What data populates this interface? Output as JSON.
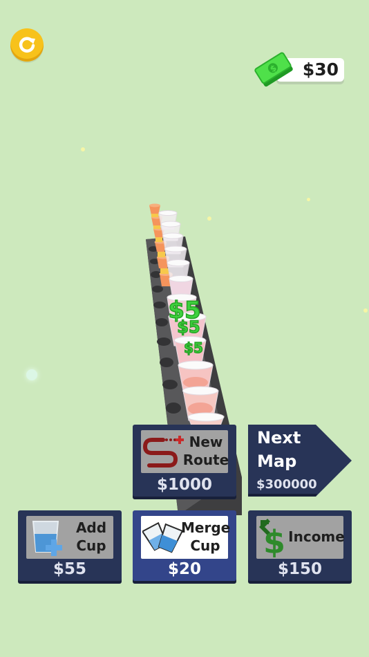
{
  "hud": {
    "money": "$30",
    "restart_icon": "restart-icon",
    "cash_icon": "cash-icon"
  },
  "floating_income": [
    "$5",
    "$5",
    "$5"
  ],
  "upgrades": {
    "new_route": {
      "label_line1": "New",
      "label_line2": "Route",
      "price": "$1000",
      "icon": "route-icon"
    },
    "next_map": {
      "label_line1": "Next",
      "label_line2": "Map",
      "price": "$300000"
    },
    "add_cup": {
      "label_line1": "Add",
      "label_line2": "Cup",
      "price": "$55",
      "icon": "add-cup-icon"
    },
    "merge_cup": {
      "label_line1": "Merge",
      "label_line2": "Cup",
      "price": "$20",
      "icon": "merge-cup-icon"
    },
    "income": {
      "label": "Income",
      "price": "$150",
      "icon": "income-icon"
    }
  },
  "colors": {
    "background": "#cde9bd",
    "panel": "#283457",
    "panel_active": "#33458a",
    "money_green": "#3ed13e",
    "coin_yellow": "#f7c21b"
  }
}
